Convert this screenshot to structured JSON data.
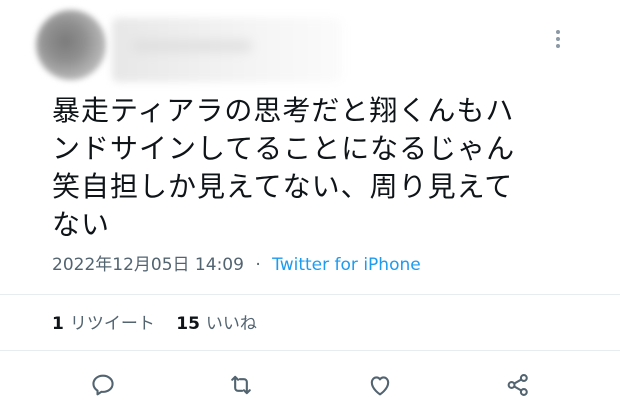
{
  "tweet": {
    "text_lines": [
      "暴走ティアラの思考だと翔くんもハ",
      "ンドサインしてることになるじゃん",
      "笑自担しか見えてない、周り見えて",
      "ない"
    ],
    "date": "2022年12月05日 14:09",
    "separator": "·",
    "source": "Twitter for iPhone",
    "stats": {
      "retweets_count": "1",
      "retweets_label": "リツイート",
      "likes_count": "15",
      "likes_label": "いいね"
    }
  },
  "icons": {
    "more": "more-vertical-icon",
    "reply": "reply-icon",
    "retweet": "retweet-icon",
    "like": "heart-icon",
    "share": "share-icon"
  },
  "colors": {
    "text": "#0f1419",
    "secondary": "#536471",
    "link": "#1d9bf0",
    "divider": "#e6ecf0"
  }
}
